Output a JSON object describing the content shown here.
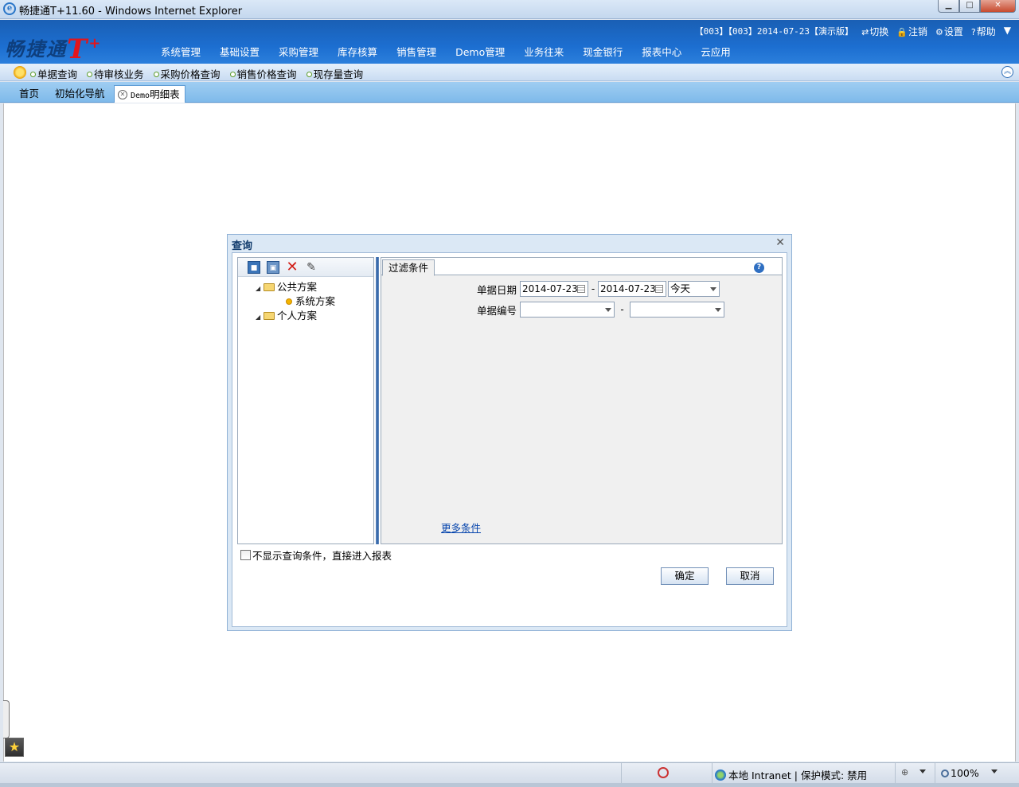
{
  "window": {
    "title": "畅捷通T+11.60 - Windows Internet Explorer",
    "min_glyph": "▁",
    "max_glyph": "□",
    "close_glyph": "✕"
  },
  "header": {
    "logo_text": "畅捷通",
    "logo_mark": "T",
    "logo_plus": "+",
    "account_info": "【003】【003】2014-07-23【演示版】",
    "links": {
      "switch": "切换",
      "logout": "注销",
      "settings": "设置",
      "help": "帮助"
    },
    "menu_glyph": "▼",
    "nav": [
      "系统管理",
      "基础设置",
      "采购管理",
      "库存核算",
      "销售管理",
      "Demo管理",
      "业务往来",
      "现金银行",
      "报表中心",
      "云应用"
    ]
  },
  "quickbar": {
    "links": [
      "单据查询",
      "待审核业务",
      "采购价格查询",
      "销售价格查询",
      "现存量查询"
    ],
    "collapse_glyph": "︽"
  },
  "tabs": {
    "home": "首页",
    "init_guide": "初始化导航",
    "active_prefix": "Demo",
    "active_suffix": "明细表",
    "close_glyph": "✕"
  },
  "dialog": {
    "title": "查询",
    "close_glyph": "✕",
    "tree": {
      "public": "公共方案",
      "system": "系统方案",
      "personal": "个人方案"
    },
    "filter_tab": "过滤条件",
    "help_glyph": "?",
    "date_label": "单据日期",
    "date_from": "2014-07-23",
    "date_to": "2014-07-23",
    "date_range": "今天",
    "dash": "-",
    "number_label": "单据编号",
    "number_from": "",
    "number_to": "",
    "more_conditions": "更多条件",
    "skip_label": "不显示查询条件，直接进入报表",
    "ok": "确定",
    "cancel": "取消"
  },
  "statusbar": {
    "zone": "本地 Intranet | 保护模式: 禁用",
    "zoom": "100%"
  },
  "colors": {
    "header_blue": "#1c6ed0",
    "logo_red": "#e3151b",
    "link_blue": "#0645ad"
  }
}
